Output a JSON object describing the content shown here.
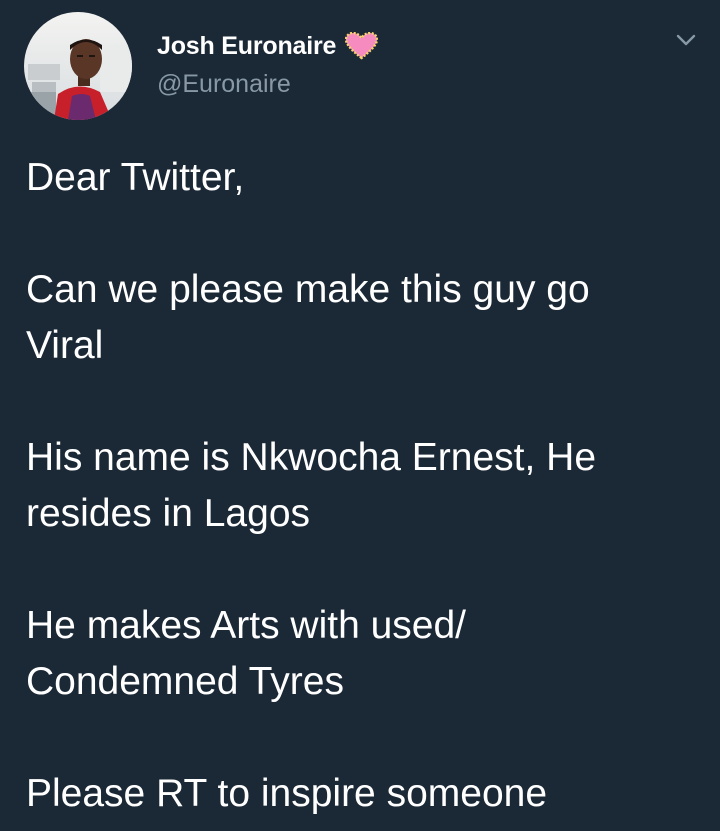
{
  "author": {
    "display_name": "Josh Euronaire",
    "handle": "@Euronaire",
    "badge_icon": "pink-heart-icon",
    "menu_icon": "chevron-down-icon"
  },
  "tweet": {
    "paragraphs": [
      {
        "lines": [
          "Dear Twitter,"
        ]
      },
      {
        "lines": [
          "Can we please make this guy go",
          "Viral"
        ]
      },
      {
        "lines": [
          "His name is Nkwocha Ernest, He",
          "resides in Lagos"
        ]
      },
      {
        "lines": [
          "He makes Arts with used/",
          "Condemned Tyres"
        ]
      },
      {
        "lines": [
          "Please RT to inspire someone"
        ]
      }
    ]
  },
  "colors": {
    "background": "#1b2836",
    "text_primary": "#ffffff",
    "text_secondary": "#8899a6",
    "heart": "#f58bbf"
  }
}
